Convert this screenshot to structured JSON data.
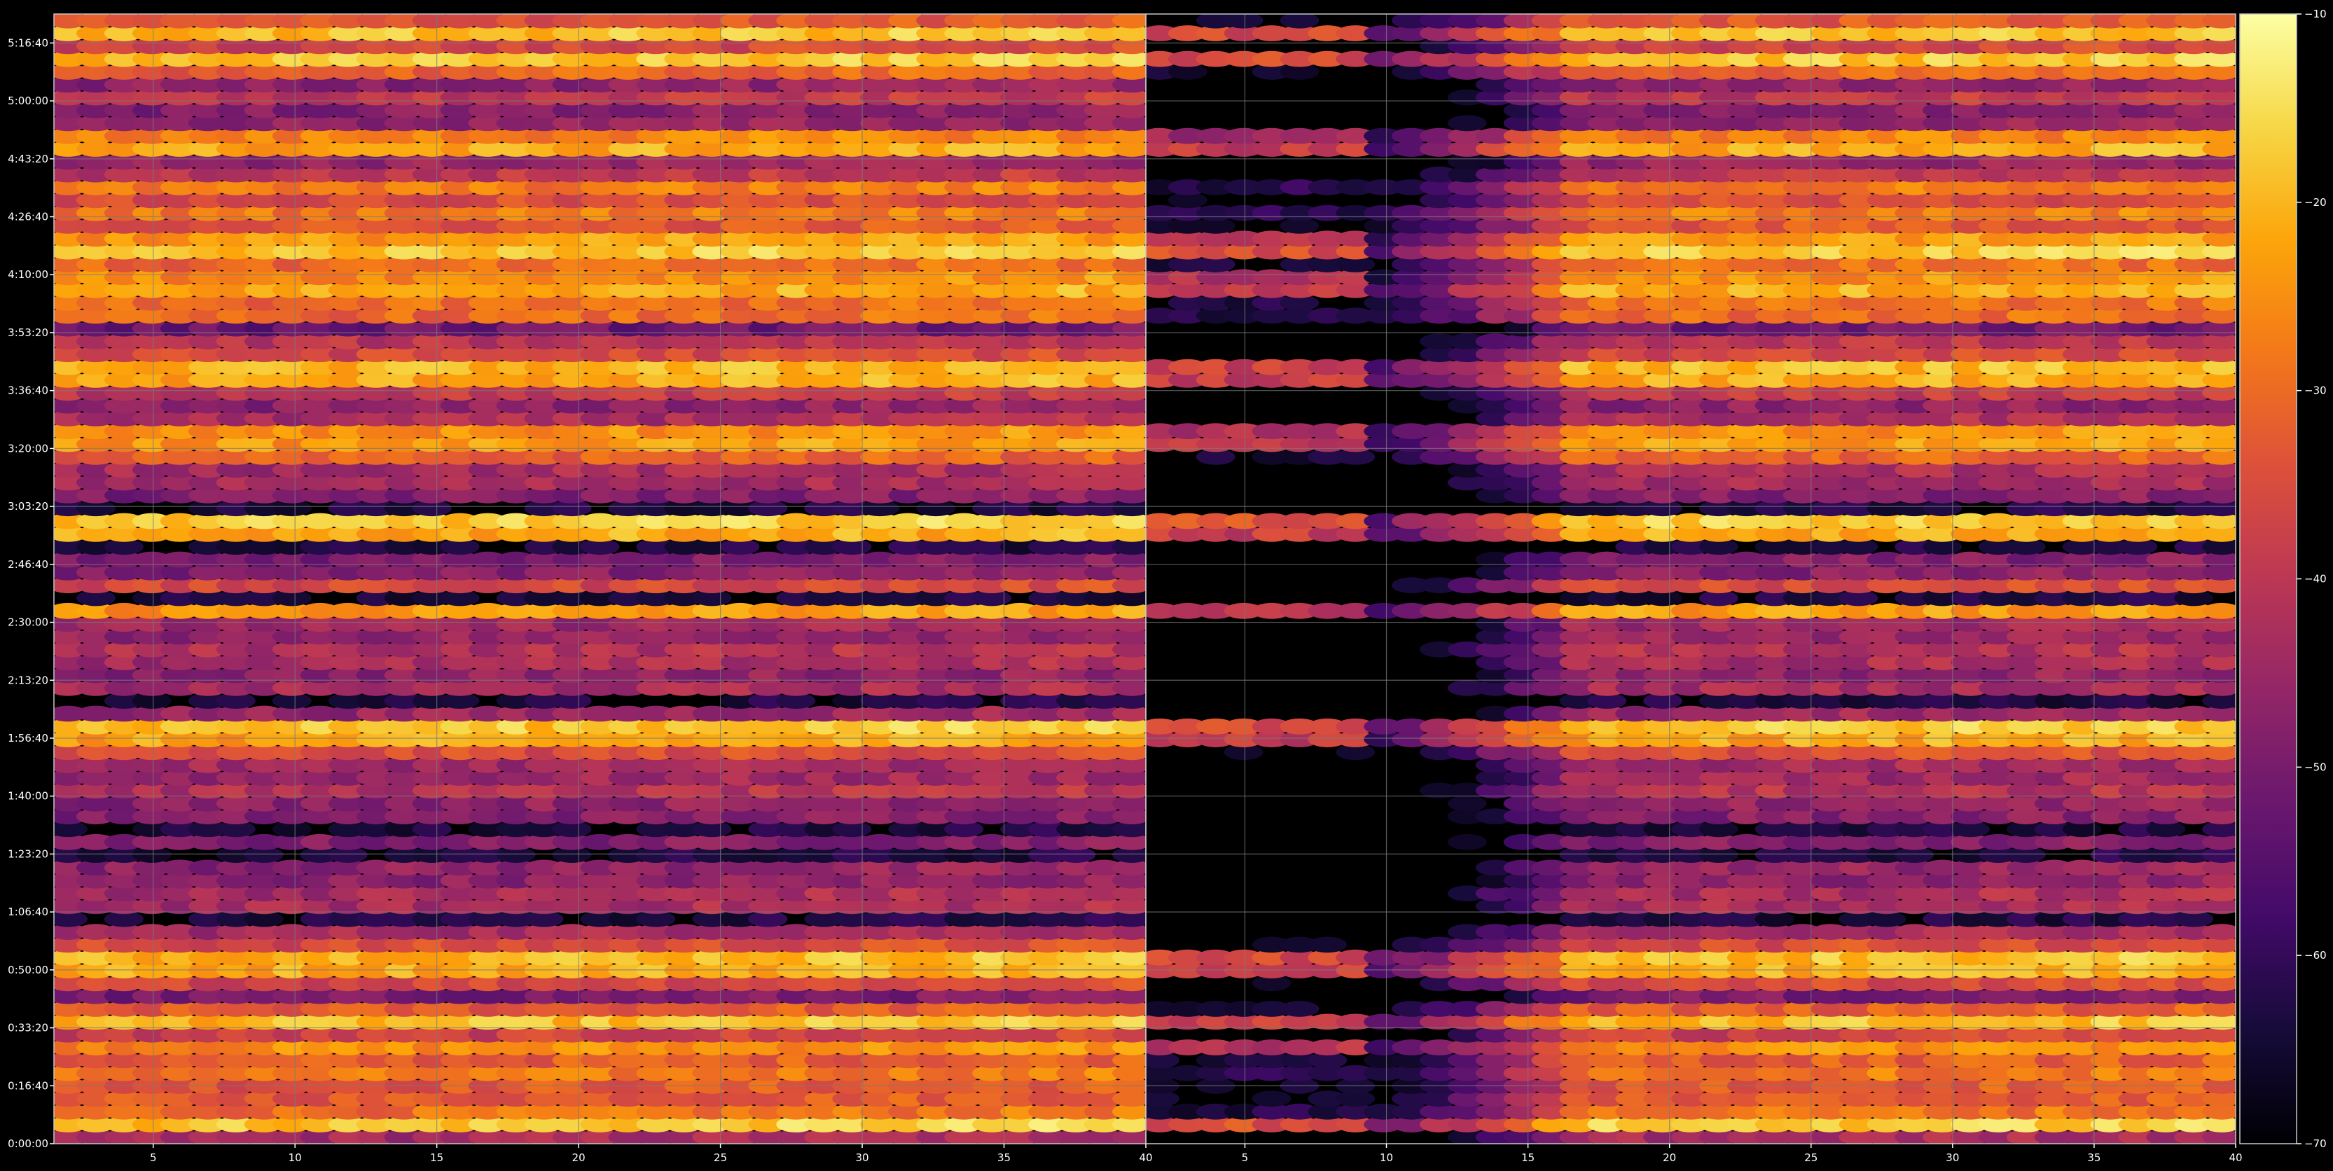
{
  "chart_data": {
    "type": "heatmap",
    "title": "",
    "xlabel": "",
    "ylabel": "",
    "panels": [
      {
        "xlim": [
          1.5,
          40
        ],
        "x_ticks": [
          5,
          10,
          15,
          20,
          25,
          30,
          35,
          40
        ],
        "x_tick_labels": [
          "5",
          "10",
          "15",
          "20",
          "25",
          "30",
          "35",
          "40"
        ]
      },
      {
        "xlim": [
          1.5,
          40
        ],
        "x_ticks": [
          5,
          10,
          15,
          20,
          25,
          30,
          35,
          40
        ],
        "x_tick_labels": [
          "5",
          "10",
          "15",
          "20",
          "25",
          "30",
          "35",
          "40"
        ]
      }
    ],
    "y_seconds_range": [
      0,
      19500
    ],
    "y_ticks_seconds": [
      0,
      1000,
      2000,
      3000,
      4000,
      5000,
      6000,
      7000,
      8000,
      9000,
      10000,
      11000,
      12000,
      13000,
      14000,
      15000,
      16000,
      17000,
      18000,
      19000
    ],
    "y_tick_labels": [
      "0:00:00",
      "0:16:40",
      "0:33:20",
      "0:50:00",
      "1:06:40",
      "1:23:20",
      "1:40:00",
      "1:56:40",
      "2:13:20",
      "2:30:00",
      "2:46:40",
      "3:03:20",
      "3:20:00",
      "3:36:40",
      "3:53:20",
      "4:10:00",
      "4:26:40",
      "4:43:20",
      "5:00:00",
      "5:16:40"
    ],
    "grid": true,
    "colormap": "inferno",
    "colorbar": {
      "position": "right",
      "range": [
        -70,
        -10
      ],
      "ticks": [
        -70,
        -60,
        -50,
        -40,
        -30,
        -20,
        -10
      ],
      "tick_labels": [
        "−70",
        "−60",
        "−50",
        "−40",
        "−30",
        "−20",
        "−10"
      ]
    },
    "strong_rows_seconds": [
      420,
      540,
      1200,
      1700,
      2100,
      3000,
      3300,
      6950,
      7000,
      7100,
      9300,
      9400,
      9500,
      10400,
      10700,
      12000,
      12200,
      13100,
      13400,
      14400,
      14650,
      15000,
      15300,
      15700,
      16000,
      16600,
      17300,
      18600,
      18700,
      19200
    ],
    "colors": {
      "background": "#000000",
      "text": "#ffffff",
      "grid": "#7a7a7a"
    }
  }
}
